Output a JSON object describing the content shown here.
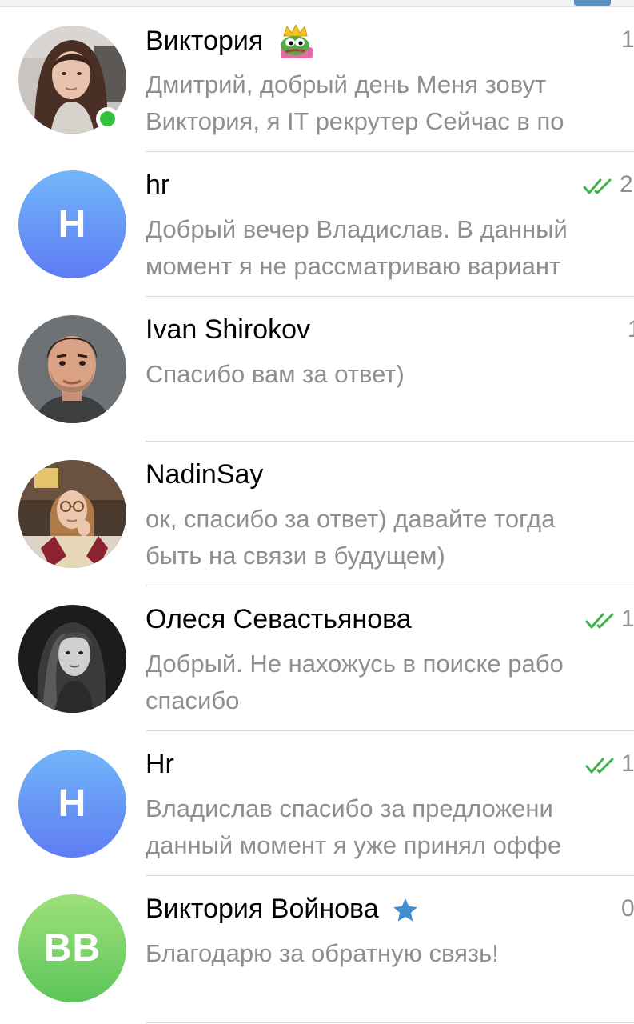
{
  "chats": [
    {
      "name": "Виктория",
      "time": "1",
      "preview_line1": "Дмитрий, добрый день Меня зовут",
      "preview_line2": "Виктория, я IT рекрутер Сейчас в по",
      "avatar": {
        "type": "photo",
        "icon": "woman-portrait"
      },
      "online": true,
      "badge": "pepe-sticker-icon"
    },
    {
      "name": "hr",
      "time": "2",
      "preview_line1": "Добрый вечер Владислав. В данный",
      "preview_line2": "момент я не рассматриваю вариант",
      "avatar": {
        "type": "letter",
        "letter": "H",
        "color": "#6a8ef5"
      },
      "read": true
    },
    {
      "name": "Ivan Shirokov",
      "time": "1",
      "preview_line1": "Спасибо вам за ответ)",
      "preview_line2": "",
      "avatar": {
        "type": "photo",
        "icon": "man-portrait"
      }
    },
    {
      "name": "NadinSay",
      "time": "",
      "preview_line1": "ок, спасибо за ответ) давайте тогда",
      "preview_line2": "быть на связи в будущем)",
      "avatar": {
        "type": "photo",
        "icon": "woman-with-glasses-portrait"
      }
    },
    {
      "name": "Олеся Севастьянова",
      "time": "1",
      "preview_line1": "Добрый. Не нахожусь в поиске рабо",
      "preview_line2": "спасибо",
      "avatar": {
        "type": "photo",
        "icon": "woman-bw-portrait"
      },
      "read": true
    },
    {
      "name": "Hr",
      "time": "1",
      "preview_line1": "Владислав спасибо за предложени",
      "preview_line2": "данный момент я уже принял оффе",
      "avatar": {
        "type": "letter",
        "letter": "H",
        "color": "#6a8ef5"
      },
      "read": true
    },
    {
      "name": "Виктория Войнова",
      "time": "0",
      "preview_line1": "Благодарю за обратную связь!",
      "preview_line2": "",
      "avatar": {
        "type": "letter",
        "letter": "BB",
        "color": "#6dcc63"
      },
      "badge": "star-icon"
    }
  ],
  "colors": {
    "accent_blue": "#3e8ed0",
    "online_green": "#32c33e",
    "check_green": "#3cb54a",
    "preview_gray": "#8e8e93"
  }
}
